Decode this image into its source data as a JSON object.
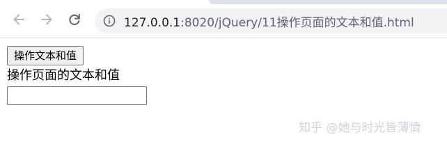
{
  "browser": {
    "url_host": "127.0.0.1",
    "url_path": ":8020/jQuery/11操作页面的文本和值.html",
    "icons": {
      "back": "back-arrow-icon",
      "forward": "forward-arrow-icon",
      "reload": "reload-icon",
      "site_info": "info-icon"
    }
  },
  "page": {
    "button_label": "操作文本和值",
    "text": "操作页面的文本和值",
    "input_value": ""
  },
  "watermark": {
    "text": "知乎 @她与时光皆薄情"
  }
}
